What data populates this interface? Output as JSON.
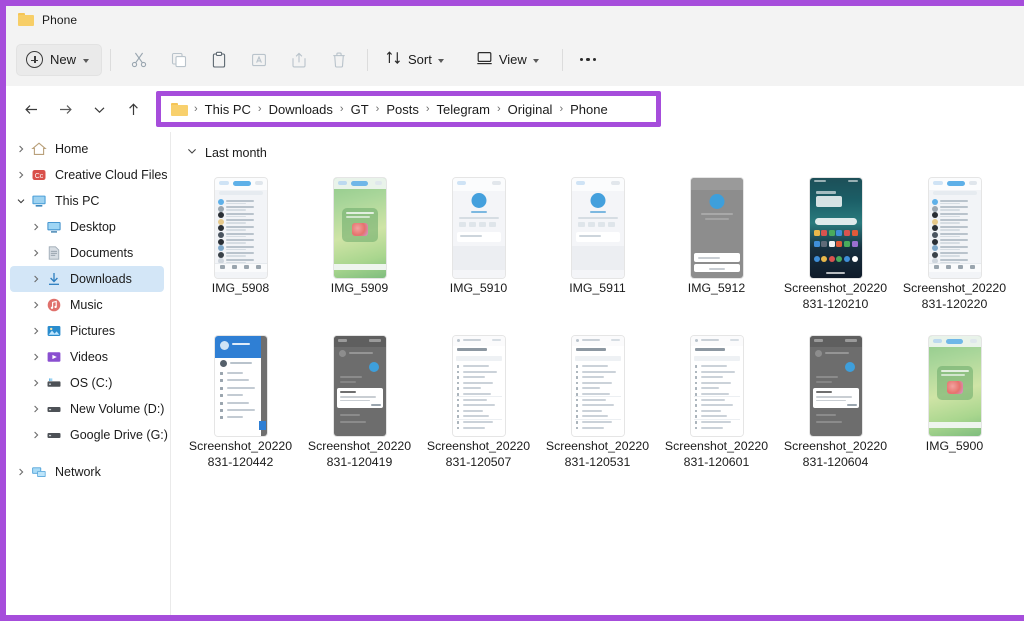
{
  "window": {
    "tab_title": "Phone",
    "tab_icon": "folder-icon",
    "highlight_color": "#a64ddb"
  },
  "toolbar": {
    "new_label": "New",
    "new_icon": "plus-circle-icon",
    "icons": [
      {
        "name": "cut-icon",
        "label": "Cut"
      },
      {
        "name": "copy-icon",
        "label": "Copy"
      },
      {
        "name": "paste-icon",
        "label": "Paste"
      },
      {
        "name": "rename-icon",
        "label": "Rename"
      },
      {
        "name": "share-icon",
        "label": "Share"
      },
      {
        "name": "delete-icon",
        "label": "Delete"
      }
    ],
    "sort_label": "Sort",
    "sort_icon": "sort-icon",
    "view_label": "View",
    "view_icon": "view-icon",
    "more_label": "See more",
    "more_icon": "ellipsis-icon"
  },
  "navigation": {
    "back_icon": "arrow-left-icon",
    "forward_icon": "arrow-right-icon",
    "recent_icon": "chevron-down-icon",
    "up_icon": "arrow-up-icon"
  },
  "breadcrumb": {
    "folder_icon": "folder-icon",
    "separator": "›",
    "items": [
      "This PC",
      "Downloads",
      "GT",
      "Posts",
      "Telegram",
      "Original",
      "Phone"
    ]
  },
  "sidebar": {
    "items": [
      {
        "label": "Home",
        "icon": "home-icon",
        "indent": 0,
        "expander": "collapsed",
        "selected": false
      },
      {
        "label": "Creative Cloud Files",
        "icon": "creative-cloud-icon",
        "indent": 0,
        "expander": "collapsed",
        "selected": false
      },
      {
        "label": "This PC",
        "icon": "this-pc-icon",
        "indent": 0,
        "expander": "expanded",
        "selected": false
      },
      {
        "label": "Desktop",
        "icon": "desktop-icon",
        "indent": 1,
        "expander": "collapsed",
        "selected": false
      },
      {
        "label": "Documents",
        "icon": "documents-icon",
        "indent": 1,
        "expander": "collapsed",
        "selected": false
      },
      {
        "label": "Downloads",
        "icon": "downloads-icon",
        "indent": 1,
        "expander": "collapsed",
        "selected": true
      },
      {
        "label": "Music",
        "icon": "music-icon",
        "indent": 1,
        "expander": "collapsed",
        "selected": false
      },
      {
        "label": "Pictures",
        "icon": "pictures-icon",
        "indent": 1,
        "expander": "collapsed",
        "selected": false
      },
      {
        "label": "Videos",
        "icon": "videos-icon",
        "indent": 1,
        "expander": "collapsed",
        "selected": false
      },
      {
        "label": "OS (C:)",
        "icon": "os-drive-icon",
        "indent": 1,
        "expander": "collapsed",
        "selected": false
      },
      {
        "label": "New Volume (D:)",
        "icon": "drive-icon",
        "indent": 1,
        "expander": "collapsed",
        "selected": false
      },
      {
        "label": "Google Drive (G:)",
        "icon": "drive-icon",
        "indent": 1,
        "expander": "collapsed",
        "selected": false
      },
      {
        "label": "Network",
        "icon": "network-icon",
        "indent": 0,
        "expander": "collapsed",
        "selected": false
      }
    ]
  },
  "content": {
    "group_label": "Last month",
    "group_icon": "chevron-down-icon",
    "files": [
      {
        "name": "IMG_5908",
        "thumb": "telegram-chat-list-light"
      },
      {
        "name": "IMG_5909",
        "thumb": "green-gradient-sticker"
      },
      {
        "name": "IMG_5910",
        "thumb": "light-profile-blue-avatar"
      },
      {
        "name": "IMG_5911",
        "thumb": "light-profile-blue-avatar"
      },
      {
        "name": "IMG_5912",
        "thumb": "dark-grey-profile-dialog"
      },
      {
        "name": "Screenshot_20220831-120210",
        "thumb": "android-home-screen"
      },
      {
        "name": "Screenshot_20220831-120220",
        "thumb": "telegram-chat-list-light"
      },
      {
        "name": "Screenshot_20220831-120442",
        "thumb": "blue-header-settings-list"
      },
      {
        "name": "Screenshot_20220831-120419",
        "thumb": "dark-dialog-overlay"
      },
      {
        "name": "Screenshot_20220831-120507",
        "thumb": "white-settings-list"
      },
      {
        "name": "Screenshot_20220831-120531",
        "thumb": "white-settings-list"
      },
      {
        "name": "Screenshot_20220831-120601",
        "thumb": "white-settings-list"
      },
      {
        "name": "Screenshot_20220831-120604",
        "thumb": "dark-dialog-overlay"
      },
      {
        "name": "IMG_5900",
        "thumb": "green-gradient-sticker"
      }
    ]
  }
}
